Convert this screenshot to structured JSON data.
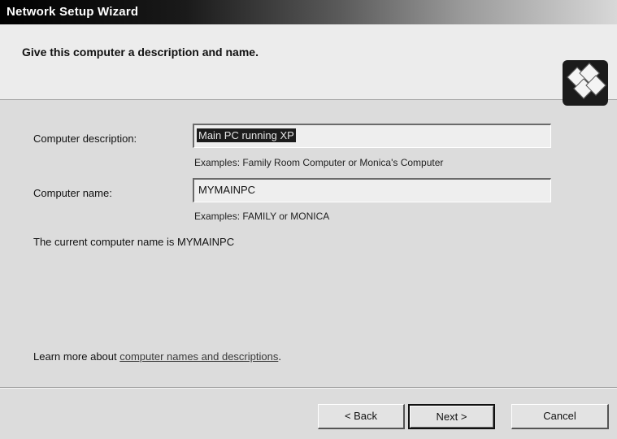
{
  "window": {
    "title": "Network Setup Wizard"
  },
  "header": {
    "title": "Give this computer a description and name."
  },
  "form": {
    "description_label": "Computer description:",
    "description_value": "Main PC running XP",
    "description_example": "Examples: Family Room Computer or Monica's Computer",
    "name_label": "Computer name:",
    "name_value": "MYMAINPC",
    "name_example": "Examples: FAMILY or MONICA",
    "current_name_text": "The current computer name is MYMAINPC"
  },
  "help": {
    "prefix": "Learn more about ",
    "link_text": "computer names and descriptions",
    "suffix": "."
  },
  "buttons": {
    "back": "< Back",
    "next": "Next >",
    "cancel": "Cancel"
  },
  "icons": {
    "header": "network-computers-icon"
  }
}
